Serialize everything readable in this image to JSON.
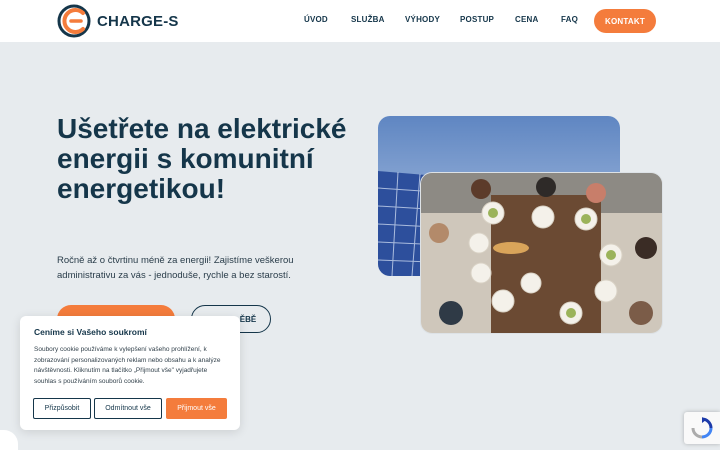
{
  "brand": {
    "name": "CHARGE-S",
    "accent": "#f47c3c",
    "dark": "#15364a"
  },
  "nav": {
    "items": [
      {
        "label": "ÚVOD"
      },
      {
        "label": "SLUŽBA"
      },
      {
        "label": "VÝHODY"
      },
      {
        "label": "POSTUP"
      },
      {
        "label": "CENA"
      },
      {
        "label": "FAQ"
      }
    ],
    "cta_label": "KONTAKT"
  },
  "hero": {
    "title": "Ušetřete na elektrické energii s komunitní energetikou!",
    "text": "Ročně až o čtvrtinu méně za energii! Zajistíme veškerou administrativu za vás - jednoduše, rychle a bez starostí.",
    "secondary_button_visible": "ĚBĚ"
  },
  "cookie": {
    "title": "Ceníme si Vašeho soukromí",
    "text": "Soubory cookie používáme k vylepšení vašeho prohlížení, k zobrazování personalizovaných reklam nebo obsahu a k analýze návštěvnosti. Kliknutím na tlačítko „Přijmout vše\" vyjadřujete souhlas s používáním souborů cookie.",
    "buttons": {
      "customize": "Přizpůsobit",
      "reject": "Odmítnout vše",
      "accept": "Přijmout vše"
    }
  },
  "icons": {
    "logo": "charge-s-logo-icon",
    "recaptcha": "recaptcha-icon"
  }
}
